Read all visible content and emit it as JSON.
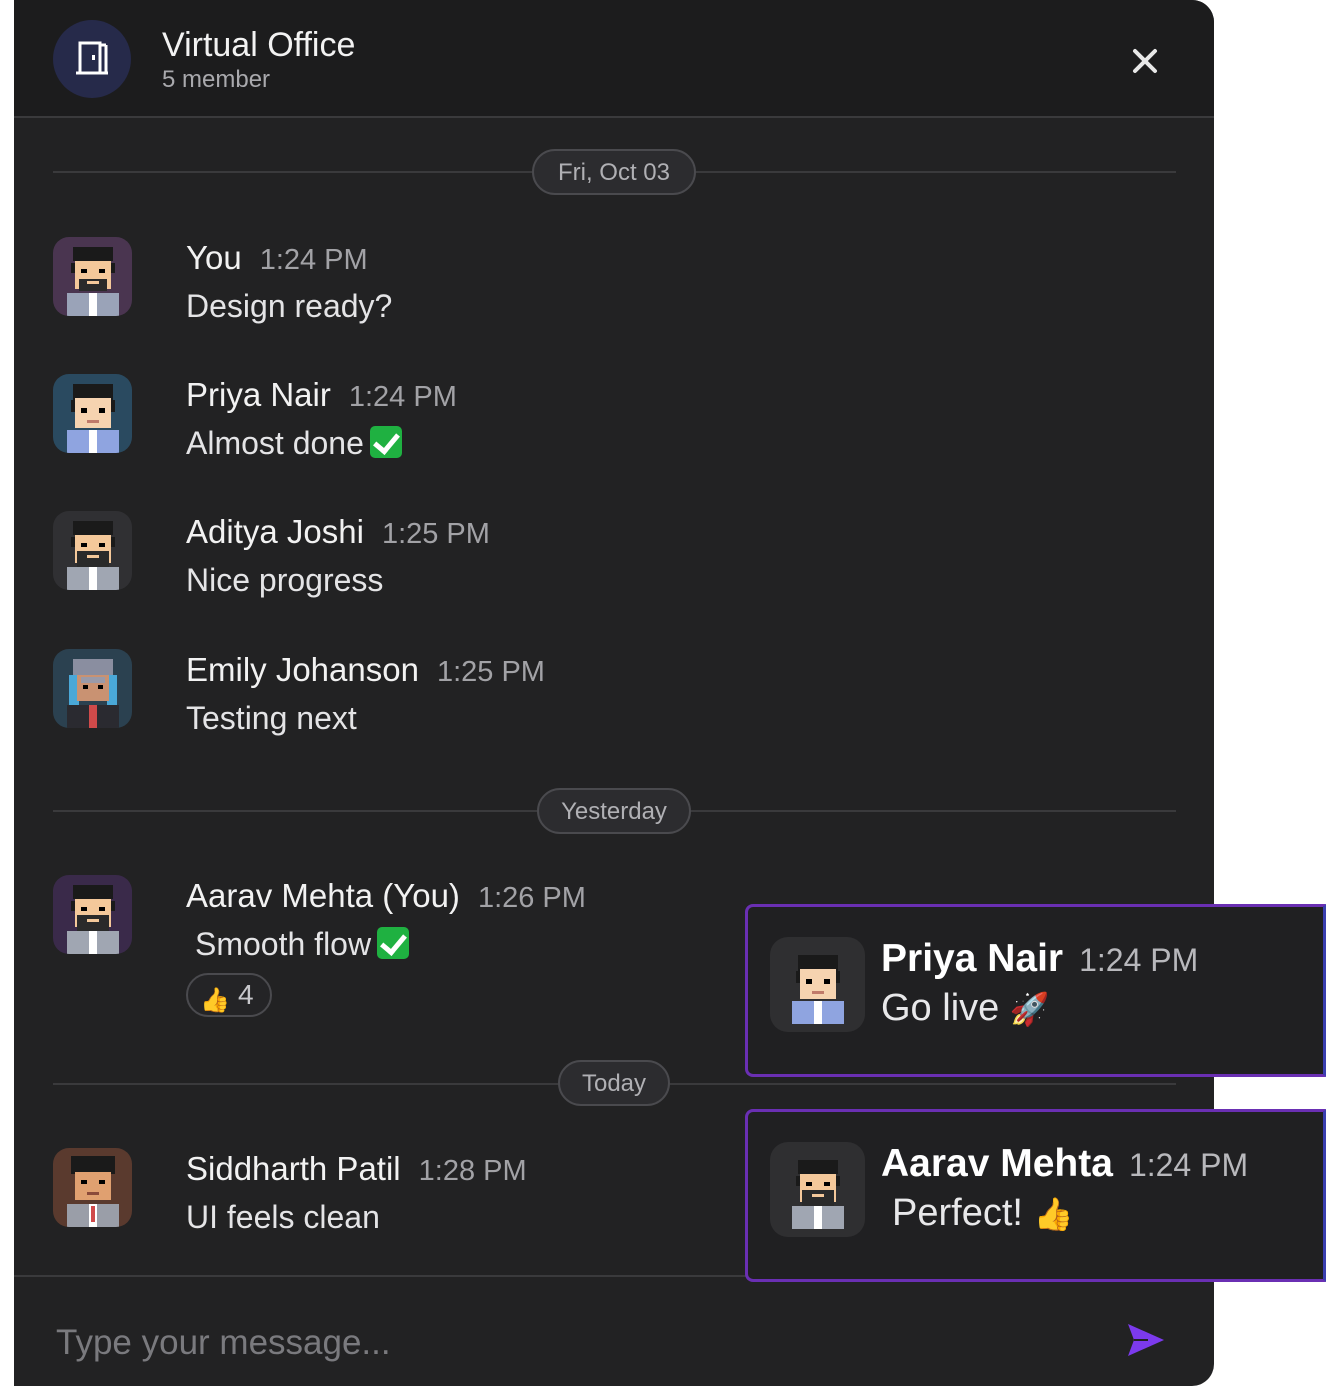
{
  "header": {
    "title": "Virtual Office",
    "subtitle": "5 member"
  },
  "dates": {
    "first": "Fri, Oct 03",
    "second": "Yesterday",
    "third": "Today"
  },
  "messages": [
    {
      "name": "You",
      "time": "1:24 PM",
      "text": "Design ready?",
      "avatar_bg": "#4a3550"
    },
    {
      "name": "Priya Nair",
      "time": "1:24 PM",
      "text": "Almost done",
      "emoji": "check-mark",
      "avatar_bg": "#2a4a60"
    },
    {
      "name": "Aditya Joshi",
      "time": "1:25 PM",
      "text": "Nice progress",
      "avatar_bg": "#303033"
    },
    {
      "name": "Emily Johanson",
      "time": "1:25 PM",
      "text": "Testing next",
      "avatar_bg": "#2b4150"
    },
    {
      "name": "Aarav Mehta (You)",
      "time": "1:26 PM",
      "text": "Smooth flow",
      "emoji": "check-mark",
      "avatar_bg": "#3a2a4a",
      "reaction": {
        "emoji": "👍",
        "count": "4"
      }
    },
    {
      "name": "Siddharth Patil",
      "time": "1:28 PM",
      "text": "UI feels clean",
      "avatar_bg": "#5a3a2e"
    }
  ],
  "composer": {
    "placeholder": "Type your message..."
  },
  "toasts": [
    {
      "name": "Priya Nair",
      "time": "1:24 PM",
      "text": "Go live",
      "emoji": "🚀"
    },
    {
      "name": "Aarav Mehta",
      "time": "1:24 PM",
      "text": "Perfect!",
      "emoji": "👍"
    }
  ],
  "colors": {
    "accent": "#7c3aed",
    "panel_bg": "#222223",
    "header_bg": "#1c1c1d",
    "toast_border": "#6a2fb3"
  },
  "icons": {
    "room": "door-icon",
    "close": "close-icon",
    "send": "send-icon"
  }
}
